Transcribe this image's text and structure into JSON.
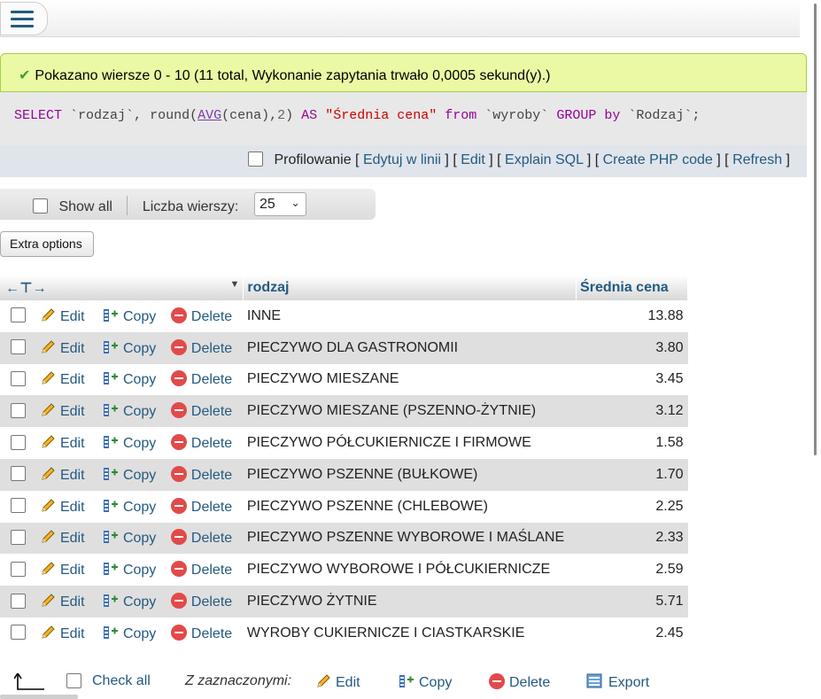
{
  "success_message": "Pokazano wiersze 0 - 10 (11 total, Wykonanie zapytania trwało 0,0005 sekund(y).)",
  "sql": {
    "select": "SELECT",
    "col1": "`rodzaj`",
    "comma1": ",",
    "round": "round(",
    "avg": "AVG",
    "avg_arg": "(cena),",
    "two": "2",
    "close": ")",
    "as": "AS",
    "alias": "\"Średnia cena\"",
    "from": "from",
    "table": "`wyroby`",
    "group_by": "GROUP by",
    "group_col": "`Rodzaj`",
    "semicolon": ";"
  },
  "sql_tools": {
    "profiling": "Profilowanie",
    "edit_inline": "Edytuj w linii",
    "edit": "Edit",
    "explain": "Explain SQL",
    "create_php": "Create PHP code",
    "refresh": "Refresh"
  },
  "nav": {
    "show_all": "Show all",
    "rows_label": "Liczba wierszy:",
    "rows_value": "25"
  },
  "extra_options": "Extra options",
  "table": {
    "col_rodzaj": "rodzaj",
    "col_avg": "Średnia cena",
    "action_edit": "Edit",
    "action_copy": "Copy",
    "action_delete": "Delete",
    "rows": [
      {
        "rodzaj": "INNE",
        "avg": "13.88"
      },
      {
        "rodzaj": "PIECZYWO DLA GASTRONOMII",
        "avg": "3.80"
      },
      {
        "rodzaj": "PIECZYWO MIESZANE",
        "avg": "3.45"
      },
      {
        "rodzaj": "PIECZYWO MIESZANE (PSZENNO-ŻYTNIE)",
        "avg": "3.12"
      },
      {
        "rodzaj": "PIECZYWO PÓŁCUKIERNICZE I FIRMOWE",
        "avg": "1.58"
      },
      {
        "rodzaj": "PIECZYWO PSZENNE (BUŁKOWE)",
        "avg": "1.70"
      },
      {
        "rodzaj": "PIECZYWO PSZENNE (CHLEBOWE)",
        "avg": "2.25"
      },
      {
        "rodzaj": "PIECZYWO PSZENNE WYBOROWE I MAŚLANE",
        "avg": "2.33"
      },
      {
        "rodzaj": "PIECZYWO WYBOROWE I PÓŁCUKIERNICZE",
        "avg": "2.59"
      },
      {
        "rodzaj": "PIECZYWO ŻYTNIE",
        "avg": "5.71"
      },
      {
        "rodzaj": "WYROBY CUKIERNICZE I CIASTKARSKIE",
        "avg": "2.45"
      }
    ]
  },
  "bottom": {
    "check_all": "Check all",
    "with_selected": "Z zaznaczonymi:",
    "edit": "Edit",
    "copy": "Copy",
    "delete": "Delete",
    "export": "Export"
  }
}
